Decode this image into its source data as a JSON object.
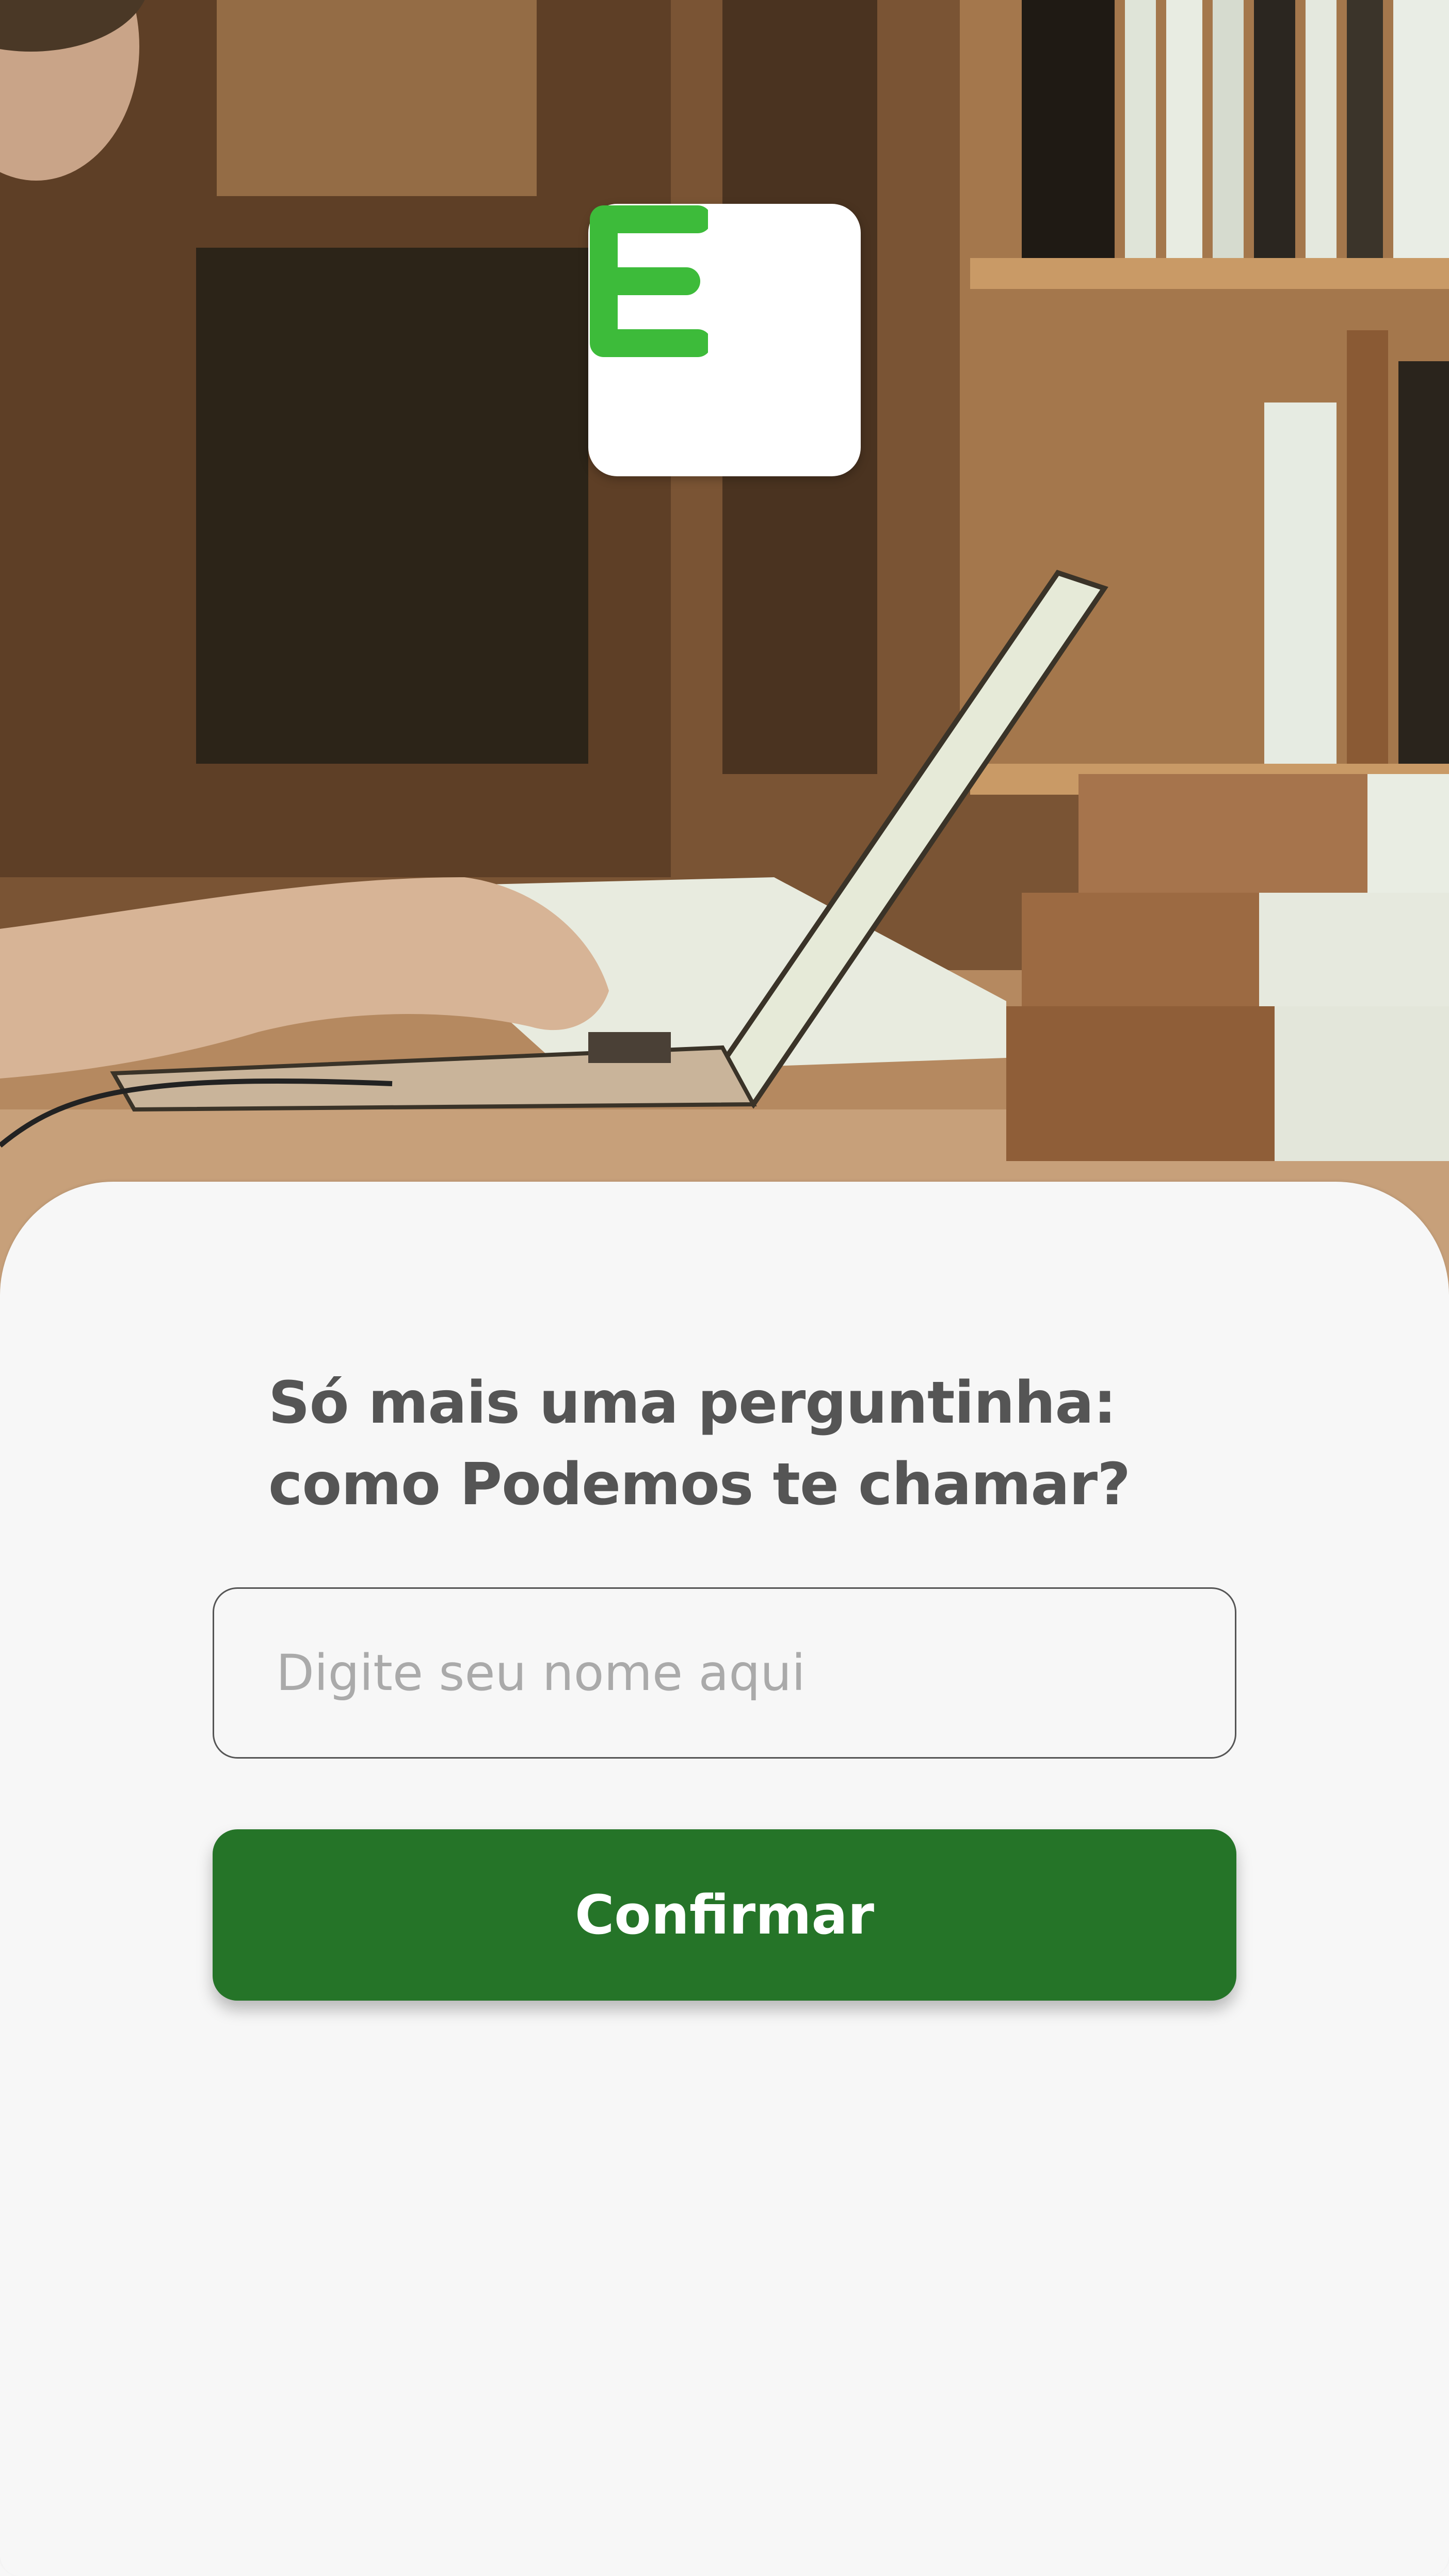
{
  "app": {
    "logo_letter": "E",
    "logo_color": "#3dbb3a",
    "logo_bg_color": "#ffffff"
  },
  "hero": {
    "image": "photo of a person typing on a laptop in a library with stacked books"
  },
  "form": {
    "question": "Só mais uma perguntinha: como Podemos te chamar?",
    "name_field": {
      "value": "",
      "placeholder": "Digite seu nome aqui"
    },
    "confirm_label": "Confirmar"
  },
  "colors": {
    "primary": "#257428",
    "text": "#555555",
    "placeholder": "#aaaaaa",
    "background": "#f7f7f7"
  }
}
